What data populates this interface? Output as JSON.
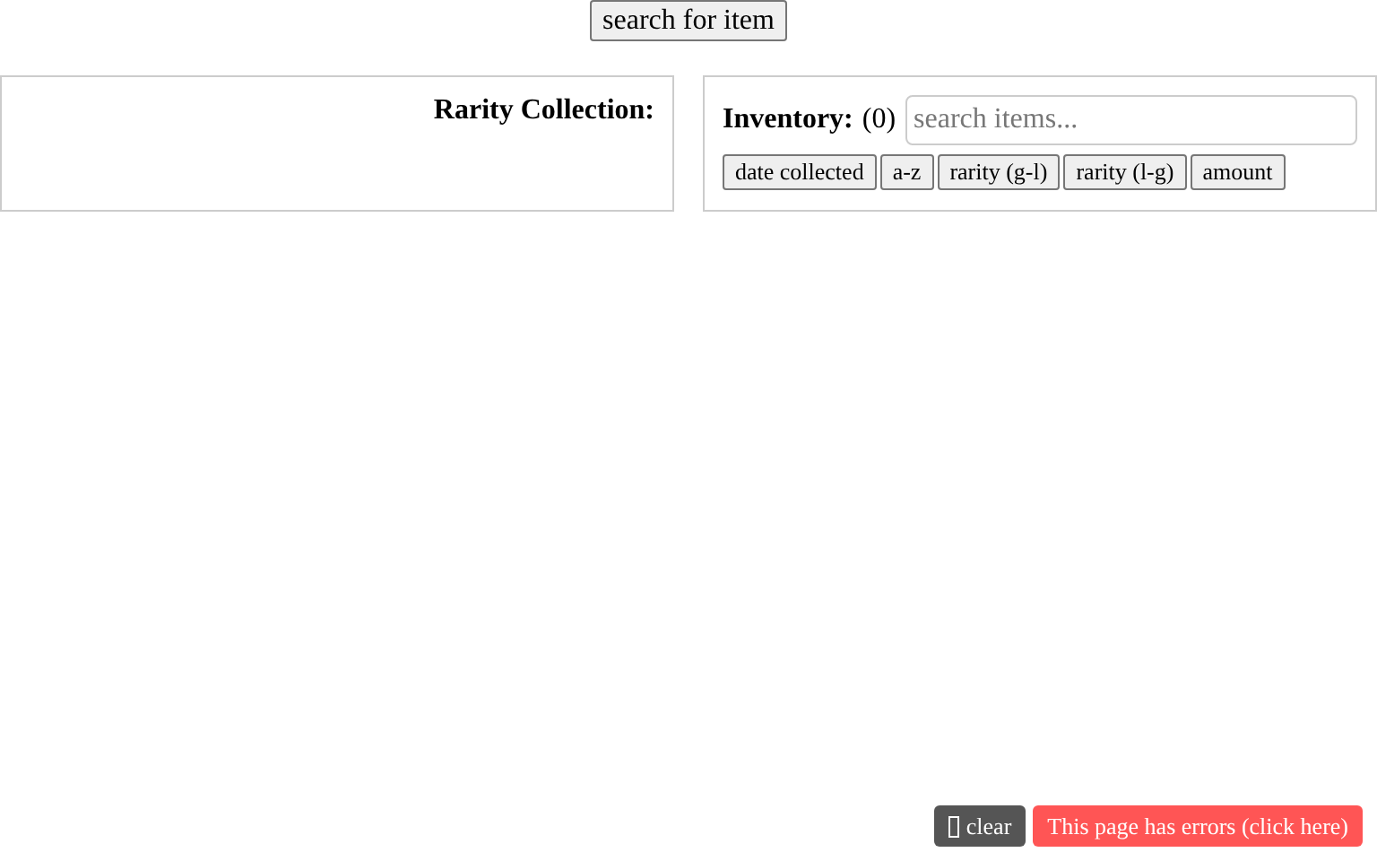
{
  "top_button": "search for item",
  "rarity_panel": {
    "title": "Rarity Collection:"
  },
  "inventory_panel": {
    "title": "Inventory:",
    "count": "(0)",
    "search": {
      "placeholder": "search items..."
    },
    "sort_buttons": [
      "date collected",
      "a-z",
      "rarity (g-l)",
      "rarity (l-g)",
      "amount"
    ]
  },
  "footer": {
    "clear_button": "clear",
    "error_button": "This page has errors (click here)"
  }
}
